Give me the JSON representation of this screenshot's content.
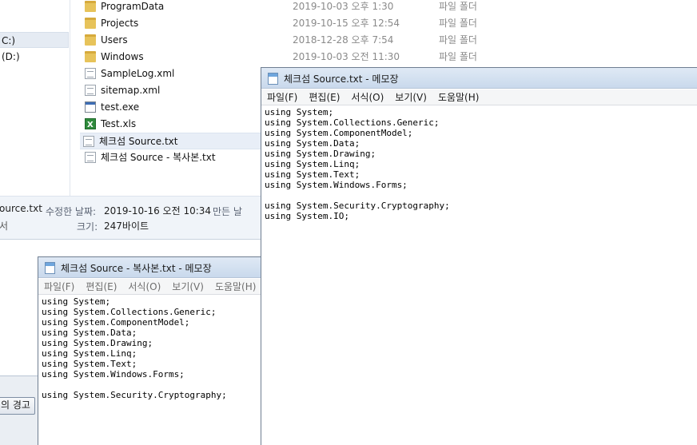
{
  "explorer": {
    "drives": [
      {
        "label": "C:)"
      },
      {
        "label": "(D:)"
      }
    ],
    "files": [
      {
        "name": "ProgramData",
        "date": "2019-10-03 오후 1:30",
        "type": "파일 폴더",
        "icon": "folder-icon"
      },
      {
        "name": "Projects",
        "date": "2019-10-15 오후 12:54",
        "type": "파일 폴더",
        "icon": "folder-icon"
      },
      {
        "name": "Users",
        "date": "2018-12-28 오후 7:54",
        "type": "파일 폴더",
        "icon": "folder-icon"
      },
      {
        "name": "Windows",
        "date": "2019-10-03 오전 11:30",
        "type": "파일 폴더",
        "icon": "folder-icon"
      },
      {
        "name": "SampleLog.xml",
        "date": "",
        "type": "",
        "icon": "xml-file-icon"
      },
      {
        "name": "sitemap.xml",
        "date": "",
        "type": "",
        "icon": "xml-file-icon"
      },
      {
        "name": "test.exe",
        "date": "",
        "type": "",
        "icon": "exe-file-icon"
      },
      {
        "name": "Test.xls",
        "date": "",
        "type": "",
        "icon": "excel-file-icon"
      },
      {
        "name": "체크섬 Source.txt",
        "date": "",
        "type": "",
        "icon": "text-file-icon",
        "selected": true
      },
      {
        "name": "체크섬 Source - 복사본.txt",
        "date": "",
        "type": "",
        "icon": "text-file-icon"
      }
    ],
    "details": {
      "name_fragment": "ource.txt",
      "kind_fragment": "서",
      "modified_label": "수정한 날짜:",
      "modified_value": "2019-10-16 오전 10:34",
      "created_label": "만든 날",
      "size_label": "크기:",
      "size_value": "247바이트"
    }
  },
  "notepad_front": {
    "title": "체크섬 Source.txt - 메모장",
    "menu": [
      "파일(F)",
      "편집(E)",
      "서식(O)",
      "보기(V)",
      "도움말(H)"
    ],
    "lines": [
      "using System;",
      "using System.Collections.Generic;",
      "using System.ComponentModel;",
      "using System.Data;",
      "using System.Drawing;",
      "using System.Linq;",
      "using System.Text;",
      "using System.Windows.Forms;",
      "",
      "using System.Security.Cryptography;",
      "using System.IO;"
    ]
  },
  "notepad_back": {
    "title": "체크섬 Source - 복사본.txt - 메모장",
    "menu": [
      "파일(F)",
      "편집(E)",
      "서식(O)",
      "보기(V)",
      "도움말(H)"
    ],
    "lines": [
      "using System;",
      "using System.Collections.Generic;",
      "using System.ComponentModel;",
      "using System.Data;",
      "using System.Drawing;",
      "using System.Linq;",
      "using System.Text;",
      "using System.Windows.Forms;",
      "",
      "using System.Security.Cryptography;"
    ]
  },
  "warning_button": {
    "label": "의 경고"
  }
}
